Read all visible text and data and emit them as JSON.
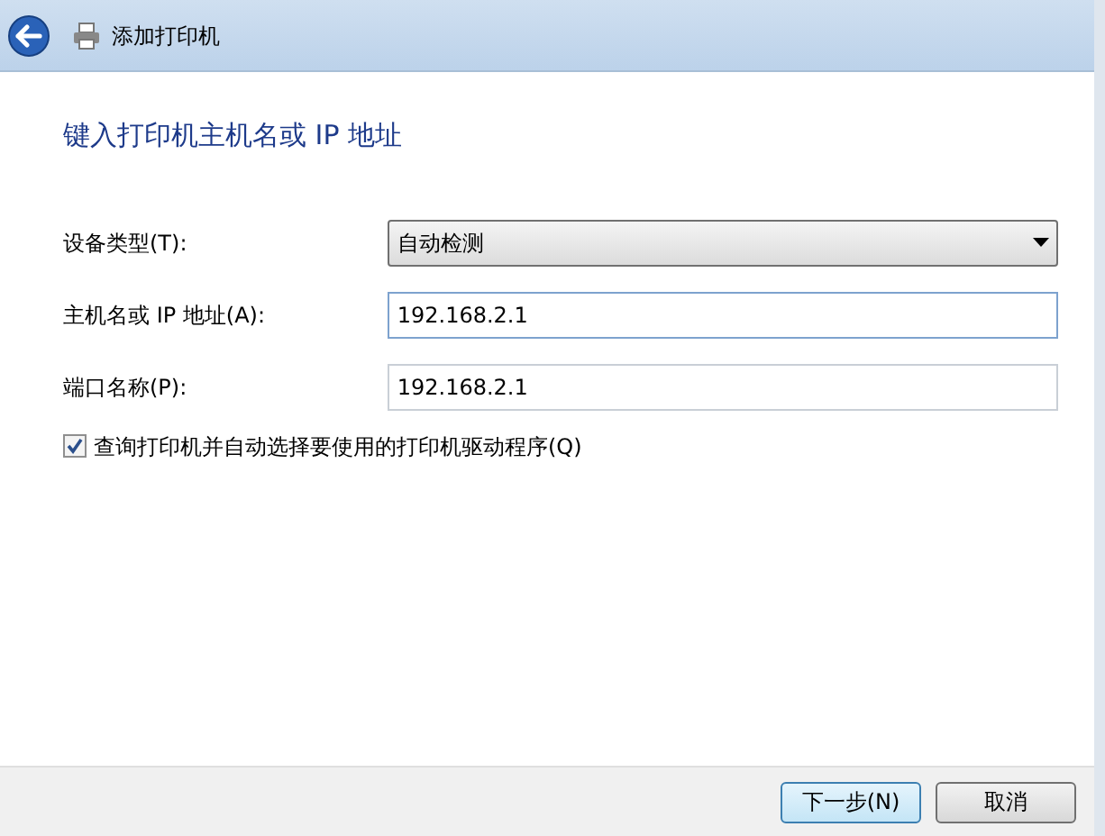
{
  "window": {
    "title": "添加打印机"
  },
  "heading": "键入打印机主机名或 IP 地址",
  "fields": [
    {
      "kind": "dropdown",
      "label": "设备类型(T):",
      "value": "自动检测",
      "focused": false
    },
    {
      "kind": "text",
      "label": "主机名或 IP 地址(A):",
      "value": "192.168.2.1",
      "focused": true
    },
    {
      "kind": "text",
      "label": "端口名称(P):",
      "value": "192.168.2.1",
      "focused": false
    }
  ],
  "query_driver": {
    "label": "查询打印机并自动选择要使用的打印机驱动程序(Q)",
    "checked": true
  },
  "buttons": [
    {
      "label": "下一步(N)",
      "default": true
    },
    {
      "label": "取消",
      "default": false
    }
  ]
}
